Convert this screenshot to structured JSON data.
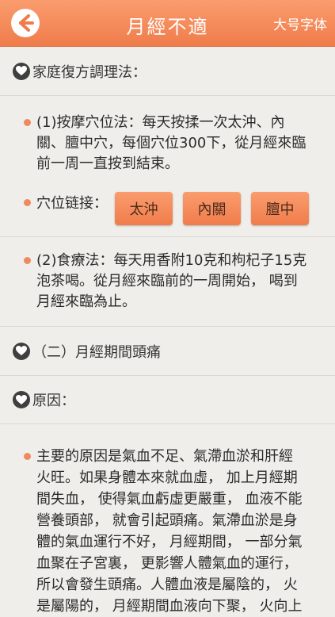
{
  "header": {
    "back_icon": "back-arrow-icon",
    "title": "月經不適",
    "font_size_label": "大号字体",
    "color": "#f27f4f"
  },
  "sections": {
    "home_remedy": {
      "heading": "家庭復方調理法："
    },
    "massage": {
      "text_lines": [
        "(1)按摩穴位法：每天按揉一次太沖、內",
        "關、膻中穴，每個穴位300下，從月經來臨",
        "前一周一直按到結束。"
      ],
      "acupoint_label": "穴位链接：",
      "acupoint_buttons": [
        "太沖",
        "內關",
        "膻中"
      ]
    },
    "diet": {
      "text_lines": [
        "(2)食療法：每天用香附10克和枸杞子15克",
        "泡茶喝。從月經來臨前的一周開始， 喝到",
        "月經來臨為止。"
      ]
    },
    "headache": {
      "heading": "（二）月經期間頭痛"
    },
    "cause": {
      "heading": "原因："
    },
    "cause_detail": {
      "text_lines": [
        "主要的原因是氣血不足、氣滯血淤和肝經",
        "火旺。如果身體本來就血虛， 加上月經期",
        "間失血， 使得氣血虧虛更嚴重， 血液不能",
        "營養頭部， 就會引起頭痛。氣滯血淤是身",
        "體的氣血運行不好， 月經期間， 一部分氣",
        "血聚在子宮裏， 更影響人體氣血的運行，",
        "所以會發生頭痛。人體血液是屬陰的， 火",
        "是屬陽的， 月經期間血液向下聚， 火向上"
      ]
    }
  },
  "icons": {
    "section_icon": "heart-icon",
    "bullet_icon": "bullet-dot-icon"
  }
}
